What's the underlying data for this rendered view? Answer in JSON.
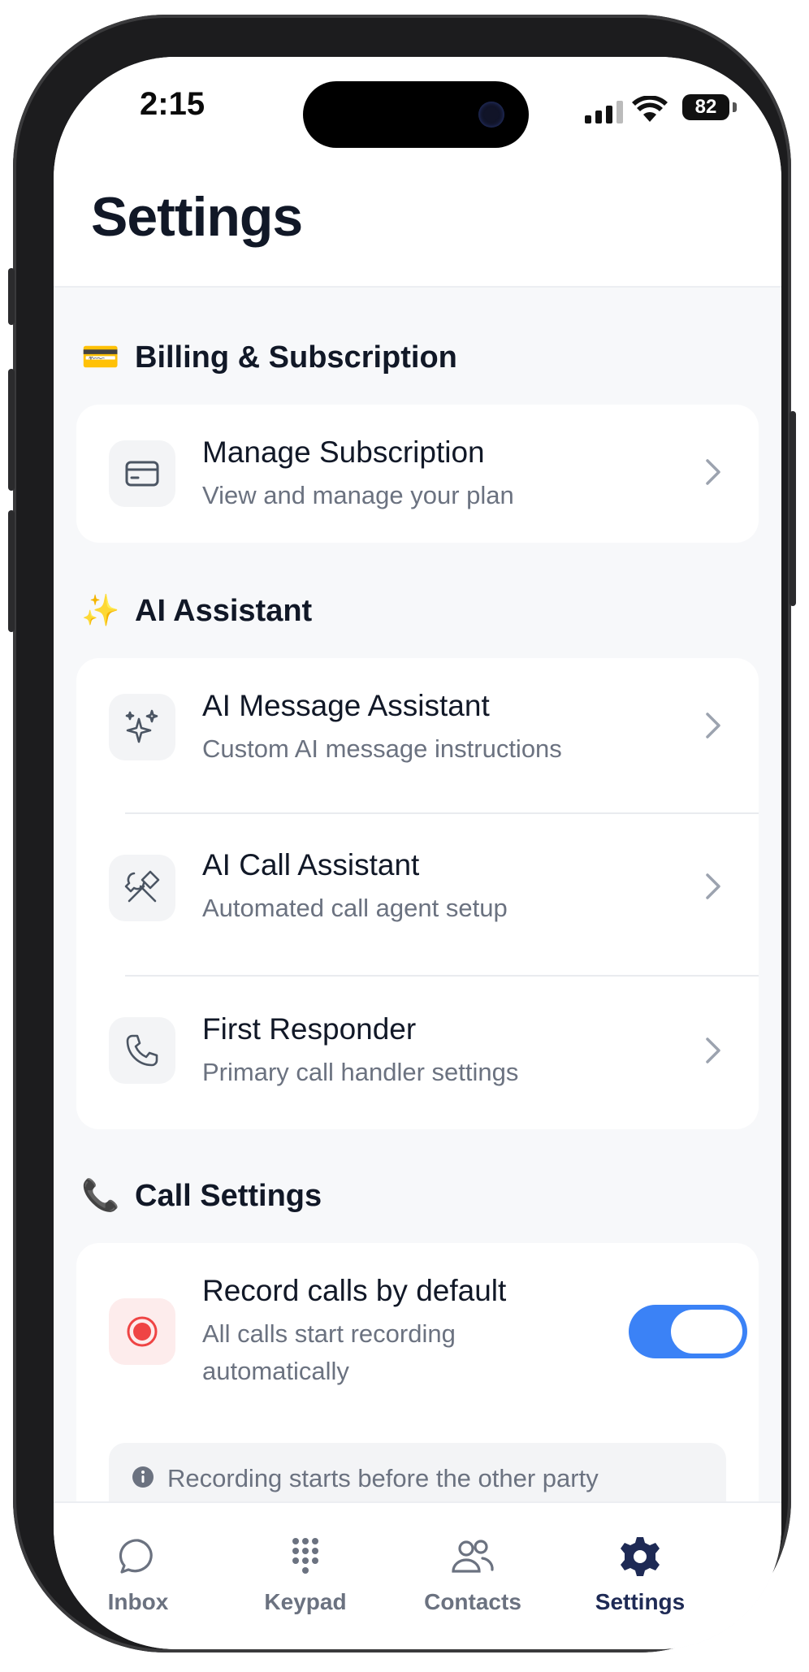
{
  "status_bar": {
    "time": "2:15",
    "battery": "82"
  },
  "header": {
    "title": "Settings"
  },
  "sections": {
    "billing": {
      "title": "Billing & Subscription",
      "emoji": "💳",
      "items": [
        {
          "title": "Manage Subscription",
          "subtitle": "View and manage your plan",
          "icon": "credit-card-icon"
        }
      ]
    },
    "ai": {
      "title": "AI Assistant",
      "emoji": "✨",
      "items": [
        {
          "title": "AI Message Assistant",
          "subtitle": "Custom AI message instructions",
          "icon": "sparkles-icon"
        },
        {
          "title": "AI Call Assistant",
          "subtitle": "Automated call agent setup",
          "icon": "tools-icon"
        },
        {
          "title": "First Responder",
          "subtitle": "Primary call handler settings",
          "icon": "phone-icon"
        }
      ]
    },
    "calls": {
      "title": "Call Settings",
      "emoji": "📞",
      "record": {
        "title": "Record calls by default",
        "subtitle_line1": "All calls start recording",
        "subtitle_line2": "automatically",
        "enabled": true,
        "icon": "record-icon"
      },
      "info_text": "Recording starts before the other party answers. You can pause or stop recording during your call."
    }
  },
  "tabs": [
    {
      "label": "Inbox",
      "icon": "chat-bubble-icon",
      "active": false
    },
    {
      "label": "Keypad",
      "icon": "keypad-icon",
      "active": false
    },
    {
      "label": "Contacts",
      "icon": "contacts-icon",
      "active": false
    },
    {
      "label": "Settings",
      "icon": "gear-icon",
      "active": true
    }
  ],
  "colors": {
    "accent": "#3b82f6",
    "active_tab": "#1e2a55",
    "record_red": "#ef4444"
  }
}
